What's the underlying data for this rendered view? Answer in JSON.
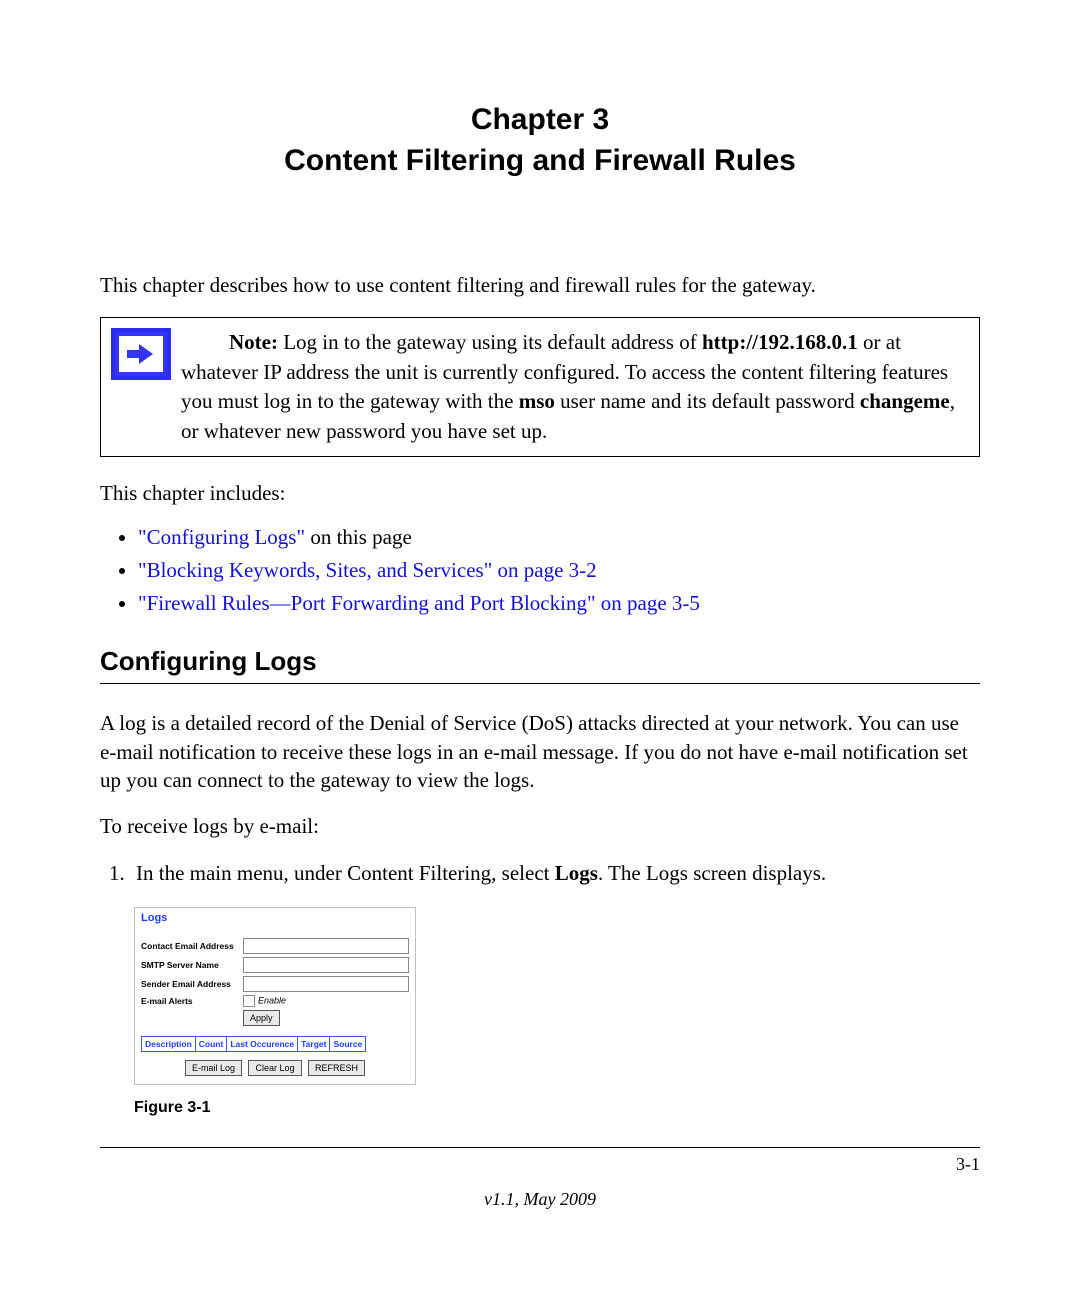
{
  "chapter": {
    "line1": "Chapter 3",
    "line2": "Content Filtering and Firewall Rules"
  },
  "intro": "This chapter describes how to use content filtering and firewall rules for the gateway.",
  "note": {
    "label": "Note:",
    "seg1": " Log in to the gateway using its default address of ",
    "bold1": "http://192.168.0.1",
    "seg2": " or at whatever IP address the unit is currently configured. To access the content filtering features you must log in to the gateway with the ",
    "bold2": "mso",
    "seg3": " user name and its default password ",
    "bold3": "changeme",
    "seg4": ", or whatever new password you have set up."
  },
  "includes_text": "This chapter includes:",
  "toc": [
    {
      "link": "\"Configuring Logs\"",
      "rest": " on this page"
    },
    {
      "link": "\"Blocking Keywords, Sites, and Services\" on page 3-2",
      "rest": ""
    },
    {
      "link": "\"Firewall Rules—Port Forwarding and Port Blocking\" on page 3-5",
      "rest": ""
    }
  ],
  "section_heading": "Configuring Logs",
  "section_para": "A log is a detailed record of the Denial of Service (DoS) attacks directed at your network. You can use e-mail notification to receive these logs in an e-mail message. If you do not have e-mail notification set up you can connect to the gateway to view the logs.",
  "receive_para": "To receive logs by e-mail:",
  "step1": {
    "lead": "1.",
    "pre": "In the main menu, under Content Filtering, select ",
    "bold": "Logs",
    "post": ". The Logs screen displays."
  },
  "logs_panel": {
    "title": "Logs",
    "labels": {
      "contact": "Contact Email Address",
      "smtp": "SMTP Server Name",
      "sender": "Sender Email Address",
      "alerts": "E-mail Alerts",
      "enable": "Enable"
    },
    "buttons": {
      "apply": "Apply",
      "email_log": "E-mail Log",
      "clear_log": "Clear Log",
      "refresh": "REFRESH"
    },
    "columns": [
      "Description",
      "Count",
      "Last Occurence",
      "Target",
      "Source"
    ]
  },
  "figure_caption": "Figure 3-1",
  "footer": {
    "page": "3-1",
    "version": "v1.1, May 2009"
  }
}
